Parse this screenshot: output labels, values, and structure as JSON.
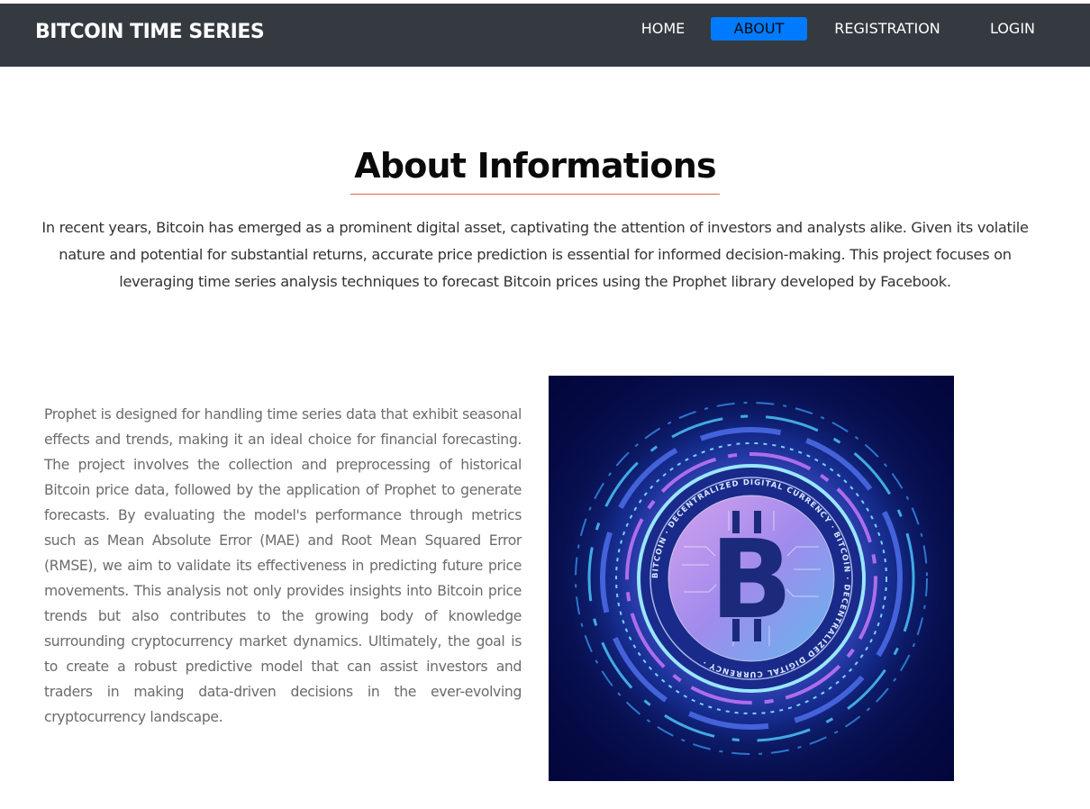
{
  "brand": "BITCOIN TIME SERIES",
  "nav": {
    "home": "HOME",
    "about": "ABOUT",
    "registration": "REGISTRATION",
    "login": "LOGIN",
    "active": "about"
  },
  "colors": {
    "navbar": "#343a40",
    "active_nav": "#007bff",
    "heading_rule": "#e0693a"
  },
  "main": {
    "title": "About Informations",
    "intro": "In recent years, Bitcoin has emerged as a prominent digital asset, captivating the attention of investors and analysts alike. Given its volatile nature and potential for substantial returns, accurate price prediction is essential for informed decision-making. This project focuses on leveraging time series analysis techniques to forecast Bitcoin prices using the Prophet library developed by Facebook.",
    "body": "Prophet is designed for handling time series data that exhibit seasonal effects and trends, making it an ideal choice for financial forecasting. The project involves the collection and preprocessing of historical Bitcoin price data, followed by the application of Prophet to generate forecasts. By evaluating the model's performance through metrics such as Mean Absolute Error (MAE) and Root Mean Squared Error (RMSE), we aim to validate its effectiveness in predicting future price movements. This analysis not only provides insights into Bitcoin price trends but also contributes to the growing body of knowledge surrounding cryptocurrency market dynamics. Ultimately, the goal is to create a robust predictive model that can assist investors and traders in making data-driven decisions in the ever-evolving cryptocurrency landscape."
  },
  "hero_image": {
    "coin_symbol": "B",
    "ring_text": "BITCOIN · DECENTRALIZED DIGITAL CURRENCY · BITCOIN · DECENTRALIZED DIGITAL CURRENCY ·"
  }
}
